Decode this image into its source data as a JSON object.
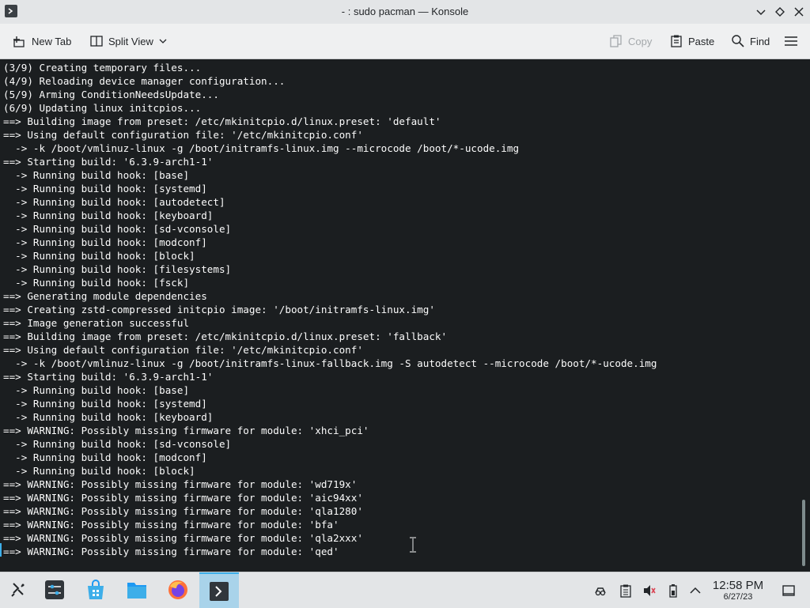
{
  "window": {
    "title": "- : sudo pacman — Konsole"
  },
  "toolbar": {
    "new_tab": "New Tab",
    "split_view": "Split View",
    "copy": "Copy",
    "paste": "Paste",
    "find": "Find"
  },
  "terminal": {
    "lines": [
      "(3/9) Creating temporary files...",
      "(4/9) Reloading device manager configuration...",
      "(5/9) Arming ConditionNeedsUpdate...",
      "(6/9) Updating linux initcpios...",
      "==> Building image from preset: /etc/mkinitcpio.d/linux.preset: 'default'",
      "==> Using default configuration file: '/etc/mkinitcpio.conf'",
      "  -> -k /boot/vmlinuz-linux -g /boot/initramfs-linux.img --microcode /boot/*-ucode.img",
      "==> Starting build: '6.3.9-arch1-1'",
      "  -> Running build hook: [base]",
      "  -> Running build hook: [systemd]",
      "  -> Running build hook: [autodetect]",
      "  -> Running build hook: [keyboard]",
      "  -> Running build hook: [sd-vconsole]",
      "  -> Running build hook: [modconf]",
      "  -> Running build hook: [block]",
      "  -> Running build hook: [filesystems]",
      "  -> Running build hook: [fsck]",
      "==> Generating module dependencies",
      "==> Creating zstd-compressed initcpio image: '/boot/initramfs-linux.img'",
      "==> Image generation successful",
      "==> Building image from preset: /etc/mkinitcpio.d/linux.preset: 'fallback'",
      "==> Using default configuration file: '/etc/mkinitcpio.conf'",
      "  -> -k /boot/vmlinuz-linux -g /boot/initramfs-linux-fallback.img -S autodetect --microcode /boot/*-ucode.img",
      "==> Starting build: '6.3.9-arch1-1'",
      "  -> Running build hook: [base]",
      "  -> Running build hook: [systemd]",
      "  -> Running build hook: [keyboard]",
      "==> WARNING: Possibly missing firmware for module: 'xhci_pci'",
      "  -> Running build hook: [sd-vconsole]",
      "  -> Running build hook: [modconf]",
      "  -> Running build hook: [block]",
      "==> WARNING: Possibly missing firmware for module: 'wd719x'",
      "==> WARNING: Possibly missing firmware for module: 'aic94xx'",
      "==> WARNING: Possibly missing firmware for module: 'qla1280'",
      "==> WARNING: Possibly missing firmware for module: 'bfa'",
      "==> WARNING: Possibly missing firmware for module: 'qla2xxx'",
      "==> WARNING: Possibly missing firmware for module: 'qed'"
    ]
  },
  "taskbar": {
    "items": [
      {
        "name": "application-launcher",
        "icon": "kde-launcher-icon"
      },
      {
        "name": "system-settings",
        "icon": "settings-sliders-icon"
      },
      {
        "name": "discover",
        "icon": "shopping-bag-icon"
      },
      {
        "name": "dolphin",
        "icon": "folder-icon"
      },
      {
        "name": "firefox",
        "icon": "firefox-icon"
      },
      {
        "name": "konsole",
        "icon": "terminal-icon",
        "active": true
      }
    ],
    "tray": [
      "game-controller-icon",
      "clipboard-icon",
      "volume-muted-icon",
      "battery-icon",
      "chevron-up-icon"
    ],
    "clock": {
      "time": "12:58 PM",
      "date": "6/27/23"
    }
  },
  "colors": {
    "terminal_bg": "#1b1e20",
    "terminal_fg": "#fcfcfc",
    "accent": "#3daee9",
    "active_task": "#a9d3ea"
  }
}
